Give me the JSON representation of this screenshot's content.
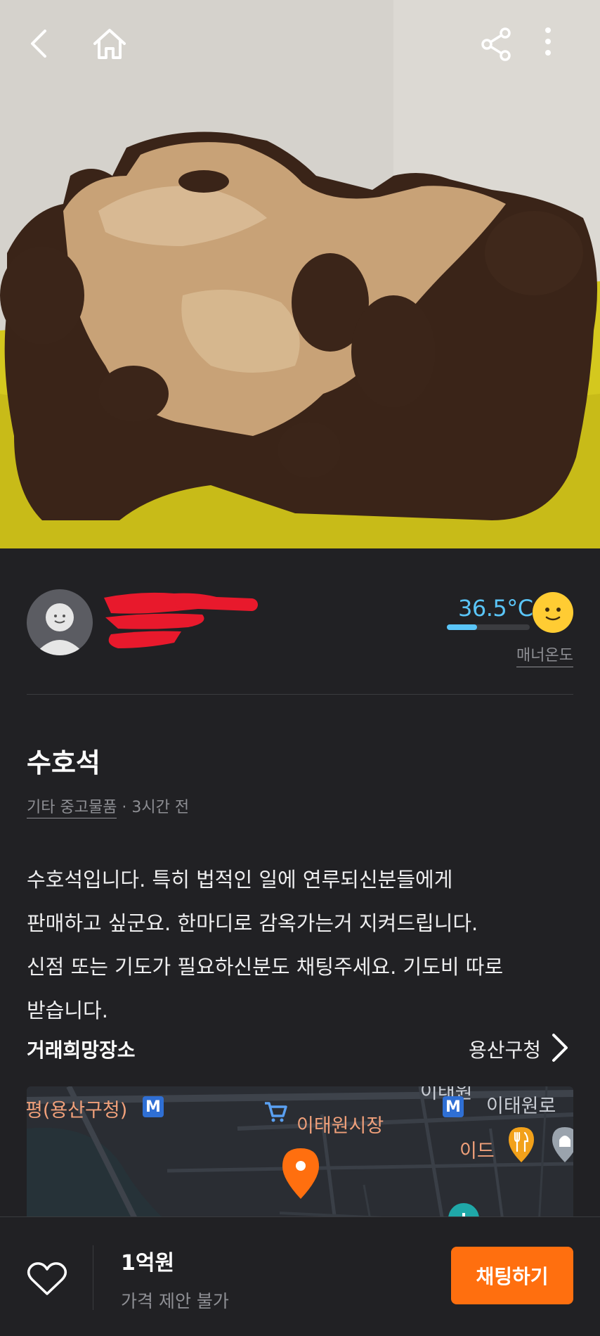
{
  "header": {
    "back_icon": "chevron-left-icon",
    "home_icon": "home-icon",
    "share_icon": "share-icon",
    "more_icon": "more-vertical-icon"
  },
  "seller": {
    "manner_temp": "36.5°C",
    "manner_temp_level": 0.365,
    "manner_label": "매너온도",
    "temp_color": "#5ac5f8",
    "face_icon": "smile-face-icon"
  },
  "post": {
    "title": "수호석",
    "category": "기타 중고물품",
    "time": " · 3시간 전",
    "description_lines": [
      "수호석입니다. 특히 법적인 일에 연루되신분들에게",
      "판매하고 싶군요. 한마디로 감옥가는거 지켜드립니다.",
      "신점 또는 기도가 필요하신분도 채팅주세요. 기도비 따로",
      "받습니다."
    ]
  },
  "place": {
    "title": "거래희망장소",
    "name": "용산구청"
  },
  "map": {
    "labels": {
      "l1": "평(용산구청)",
      "l2": "이태원시장",
      "l3": "이태원로",
      "l4": "이드",
      "l5": "이태원"
    },
    "metro": "M"
  },
  "bottom": {
    "price": "1억원",
    "price_note": "가격 제안 불가",
    "chat_label": "채팅하기",
    "accent": "#ff6f0f"
  }
}
